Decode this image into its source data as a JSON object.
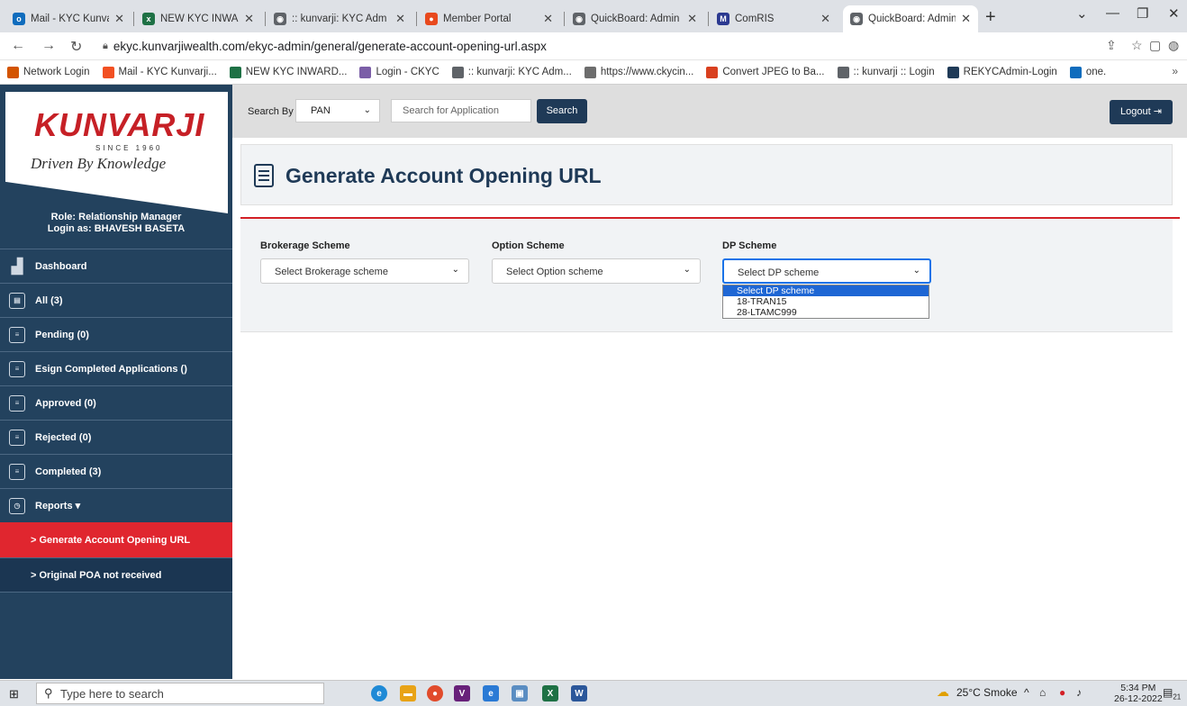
{
  "browser": {
    "tabs": [
      {
        "title": "Mail - KYC Kunvarji",
        "icon": "outlook-icon",
        "color": "#0f6cbd",
        "glyph": "o"
      },
      {
        "title": "NEW KYC INWARD",
        "icon": "excel-icon",
        "color": "#1e7145",
        "glyph": "x"
      },
      {
        "title": ":: kunvarji: KYC Adm",
        "icon": "globe-icon",
        "color": "#5f6368",
        "glyph": "◉"
      },
      {
        "title": "Member Portal",
        "icon": "portal-icon",
        "color": "#e8491d",
        "glyph": "●"
      },
      {
        "title": "QuickBoard: Admin",
        "icon": "globe-icon",
        "color": "#5f6368",
        "glyph": "◉"
      },
      {
        "title": "ComRIS",
        "icon": "mcx-icon",
        "color": "#2b3990",
        "glyph": "M"
      },
      {
        "title": "QuickBoard: Admin",
        "icon": "globe-icon",
        "color": "#5f6368",
        "glyph": "◉"
      }
    ],
    "active_tab": 6,
    "url": "ekyc.kunvarjiwealth.com/ekyc-admin/general/generate-account-opening-url.aspx",
    "bookmarks": [
      {
        "label": "Network Login",
        "icon": "network-icon",
        "color": "#d35400"
      },
      {
        "label": "Mail - KYC Kunvarji...",
        "icon": "microsoft-icon",
        "color": "#f25022"
      },
      {
        "label": "NEW KYC INWARD...",
        "icon": "excel-icon",
        "color": "#1e7145"
      },
      {
        "label": "Login - CKYC",
        "icon": "ckyc-icon",
        "color": "#7b5ea7"
      },
      {
        "label": ":: kunvarji: KYC Adm...",
        "icon": "globe-icon",
        "color": "#5f6368"
      },
      {
        "label": "https://www.ckycin...",
        "icon": "clock-icon",
        "color": "#6d6d6d"
      },
      {
        "label": "Convert JPEG to Ba...",
        "icon": "convert-icon",
        "color": "#d9401f"
      },
      {
        "label": ":: kunvarji :: Login",
        "icon": "globe-icon",
        "color": "#5f6368"
      },
      {
        "label": "REKYCAdmin-Login",
        "icon": "k-icon",
        "color": "#1f3a57"
      },
      {
        "label": "one.",
        "icon": "outlook-icon",
        "color": "#0f6cbd"
      }
    ]
  },
  "brand": {
    "name": "KUNVARJI",
    "since": "SINCE 1960",
    "tagline": "Driven By Knowledge",
    "accent": "#c62026",
    "sidebar_bg": "#23425e"
  },
  "user": {
    "role": "Role: Relationship Manager",
    "login": "Login as: BHAVESH BASETA"
  },
  "menu": [
    {
      "label": "Dashboard",
      "icon": "dashboard-icon"
    },
    {
      "label": "All (3)",
      "icon": "document-icon"
    },
    {
      "label": "Pending (0)",
      "icon": "list-icon"
    },
    {
      "label": "Esign Completed Applications ()",
      "icon": "list-icon"
    },
    {
      "label": "Approved (0)",
      "icon": "list-icon"
    },
    {
      "label": "Rejected (0)",
      "icon": "list-icon"
    },
    {
      "label": "Completed (3)",
      "icon": "list-icon"
    },
    {
      "label": "Reports ▾",
      "icon": "reports-icon"
    }
  ],
  "submenu": [
    {
      "label": "> Generate Account Opening URL",
      "active": true
    },
    {
      "label": "> Original POA not received",
      "active": false
    }
  ],
  "search": {
    "label": "Search By",
    "by_value": "PAN",
    "placeholder": "Search for Application",
    "button": "Search"
  },
  "logout_label": "Logout ⇥",
  "page_title": "Generate Account Opening URL",
  "form": {
    "brokerage": {
      "label": "Brokerage Scheme",
      "value": "Select Brokerage scheme"
    },
    "option": {
      "label": "Option Scheme",
      "value": "Select Option scheme"
    },
    "dp": {
      "label": "DP Scheme",
      "value": "Select DP scheme",
      "options": [
        "Select DP scheme",
        "18-TRAN15",
        "28-LTAMC999"
      ],
      "highlighted": 0
    }
  },
  "taskbar": {
    "search_placeholder": "Type here to search",
    "weather": "25°C Smoke",
    "time": "5:34 PM",
    "date": "26-12-2022",
    "notifications": "21"
  }
}
